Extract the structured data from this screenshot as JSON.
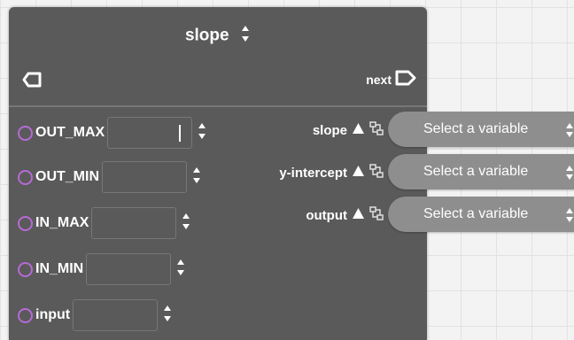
{
  "node": {
    "title": "slope",
    "next_label": "next",
    "inputs": [
      {
        "label": "OUT_MAX",
        "value": ""
      },
      {
        "label": "OUT_MIN",
        "value": ""
      },
      {
        "label": "IN_MAX",
        "value": ""
      },
      {
        "label": "IN_MIN",
        "value": ""
      },
      {
        "label": "input",
        "value": ""
      }
    ],
    "outputs": [
      {
        "label": "slope",
        "variable_placeholder": "Select a variable"
      },
      {
        "label": "y-intercept",
        "variable_placeholder": "Select a variable"
      },
      {
        "label": "output",
        "variable_placeholder": "Select a variable"
      }
    ]
  },
  "icons": {
    "title_sort": "up-down-arrows-icon",
    "flow_in": "flow-in-port-icon",
    "flow_next": "flow-out-port-icon",
    "input_port": "input-port-icon",
    "spinner": "spinner-arrows-icon",
    "warning": "warning-triangle-icon",
    "variable": "variable-link-icon"
  },
  "colors": {
    "node_background": "#5a5a5a",
    "port_ring": "#b66ad6",
    "pill_background": "#8e8e8e",
    "canvas_grid": "#e2e2e2"
  }
}
